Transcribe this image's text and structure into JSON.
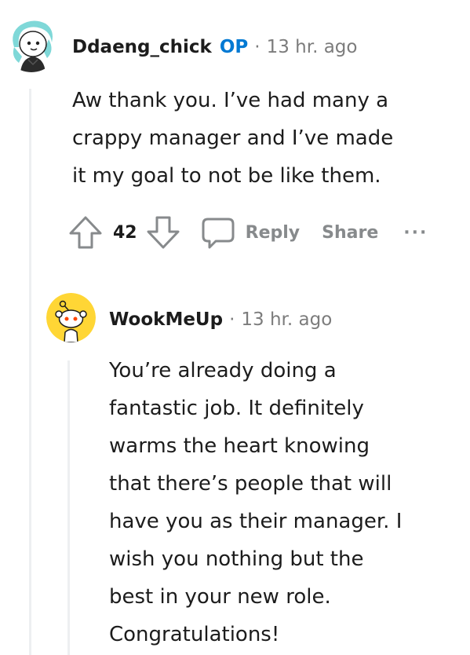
{
  "comment": {
    "author": "Ddaeng_chick",
    "op_badge": "OP",
    "separator": "·",
    "time": "13 hr. ago",
    "body_lines": [
      "Aw thank you. I’ve had many a",
      "crappy manager and I’ve made",
      "it my goal to not be like them."
    ],
    "score": "42",
    "actions": {
      "reply": "Reply",
      "share": "Share",
      "more": "···"
    },
    "icons": {
      "upvote": "upvote-arrow-icon",
      "downvote": "downvote-arrow-icon",
      "reply": "comment-bubble-icon"
    }
  },
  "reply": {
    "author": "WookMeUp",
    "separator": "·",
    "time": "13 hr. ago",
    "body_lines": [
      "You’re already doing a",
      "fantastic job. It definitely",
      "warms the heart knowing",
      "that there’s people that will",
      "have you as their manager. I",
      "wish you nothing but the",
      "best in your new role.",
      "Congratulations!"
    ]
  },
  "colors": {
    "op_blue": "#0079d3",
    "meta_gray": "#7c7c7c",
    "action_gray": "#878a8c",
    "thread_line": "#edeff1",
    "avatar_yellow": "#ffd635"
  }
}
